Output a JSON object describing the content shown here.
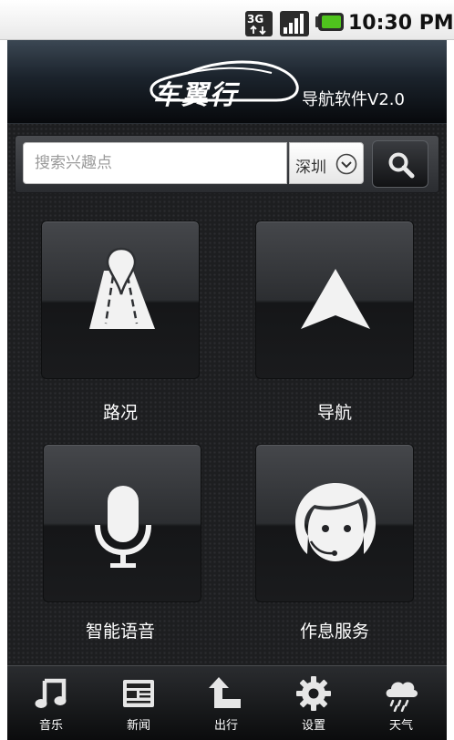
{
  "status_bar": {
    "network": "3G",
    "time": "10:30 PM"
  },
  "header": {
    "logo_text": "车翼行",
    "subtitle": "导航软件V2.0"
  },
  "search": {
    "placeholder": "搜索兴趣点",
    "value": "",
    "city": "深圳"
  },
  "tiles": [
    {
      "label": "路况",
      "icon": "road-pin-icon"
    },
    {
      "label": "导航",
      "icon": "navigation-arrow-icon"
    },
    {
      "label": "智能语音",
      "icon": "microphone-icon"
    },
    {
      "label": "作息服务",
      "icon": "headset-face-icon"
    }
  ],
  "bottom_nav": {
    "items": [
      {
        "label": "音乐",
        "icon": "music-note-icon"
      },
      {
        "label": "新闻",
        "icon": "newspaper-icon"
      },
      {
        "label": "出行",
        "icon": "turn-arrow-icon"
      },
      {
        "label": "设置",
        "icon": "gear-icon"
      },
      {
        "label": "天气",
        "icon": "rain-cloud-icon"
      }
    ]
  },
  "colors": {
    "background": "#1d1e20",
    "header_top": "#3b4753",
    "text": "#ffffff",
    "status_bar": "#f0f0f0",
    "battery_green": "#4fc31d"
  }
}
